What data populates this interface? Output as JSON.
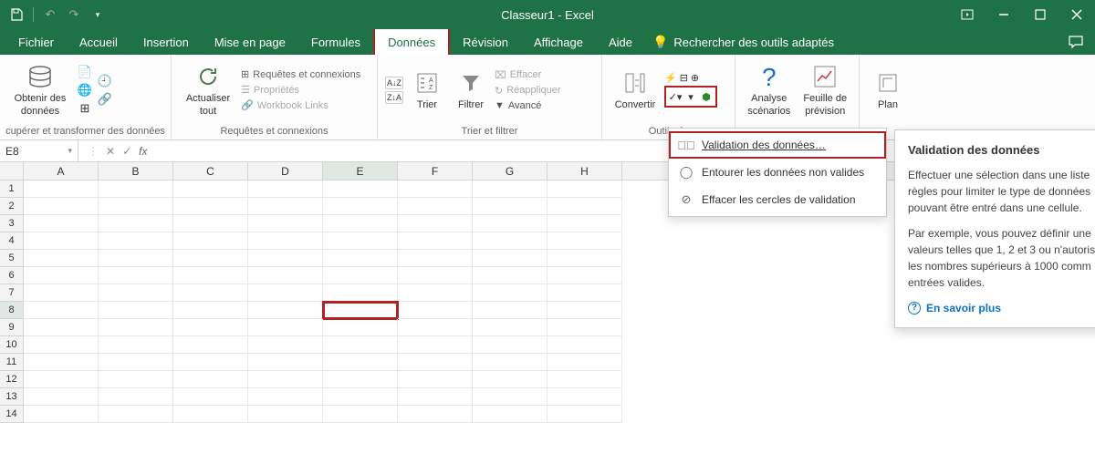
{
  "titlebar": {
    "title": "Classeur1  ‑  Excel"
  },
  "tabs": {
    "items": [
      "Fichier",
      "Accueil",
      "Insertion",
      "Mise en page",
      "Formules",
      "Données",
      "Révision",
      "Affichage",
      "Aide"
    ],
    "active_index": 5,
    "tellme_placeholder": "Rechercher des outils adaptés"
  },
  "ribbon": {
    "get_data": {
      "label": "Obtenir des\ndonnées",
      "group": "cupérer et transformer des données"
    },
    "refresh": {
      "label": "Actualiser\ntout"
    },
    "queries": {
      "q": "Requêtes et connexions",
      "p": "Propriétés",
      "w": "Workbook Links",
      "group": "Requêtes et connexions"
    },
    "sort": {
      "sort": "Trier",
      "filter": "Filtrer",
      "clear": "Effacer",
      "reapply": "Réappliquer",
      "advanced": "Avancé",
      "group": "Trier et filtrer"
    },
    "tools": {
      "convert": "Convertir",
      "group": "Outils de"
    },
    "analysis": {
      "scenarios": "Analyse\nscénarios",
      "forecast": "Feuille de\nprévision"
    },
    "plan": {
      "label": "Plan"
    }
  },
  "dropdown": {
    "items": [
      "Validation des données…",
      "Entourer les données non valides",
      "Effacer les cercles de validation"
    ]
  },
  "tooltip": {
    "title": "Validation des données",
    "p1": "Effectuer une sélection dans une liste règles pour limiter le type de données pouvant être entré dans une cellule.",
    "p2": "Par exemple, vous pouvez définir une valeurs telles que 1, 2 et 3 ou n'autoris les nombres supérieurs à 1000 comm entrées valides.",
    "link": "En savoir plus"
  },
  "formula": {
    "cellref": "E8"
  },
  "grid": {
    "cols": [
      "A",
      "B",
      "C",
      "D",
      "E",
      "F",
      "G",
      "H"
    ],
    "rows": [
      1,
      2,
      3,
      4,
      5,
      6,
      7,
      8,
      9,
      10,
      11,
      12,
      13,
      14
    ],
    "active_col": 4,
    "active_row": 7
  }
}
